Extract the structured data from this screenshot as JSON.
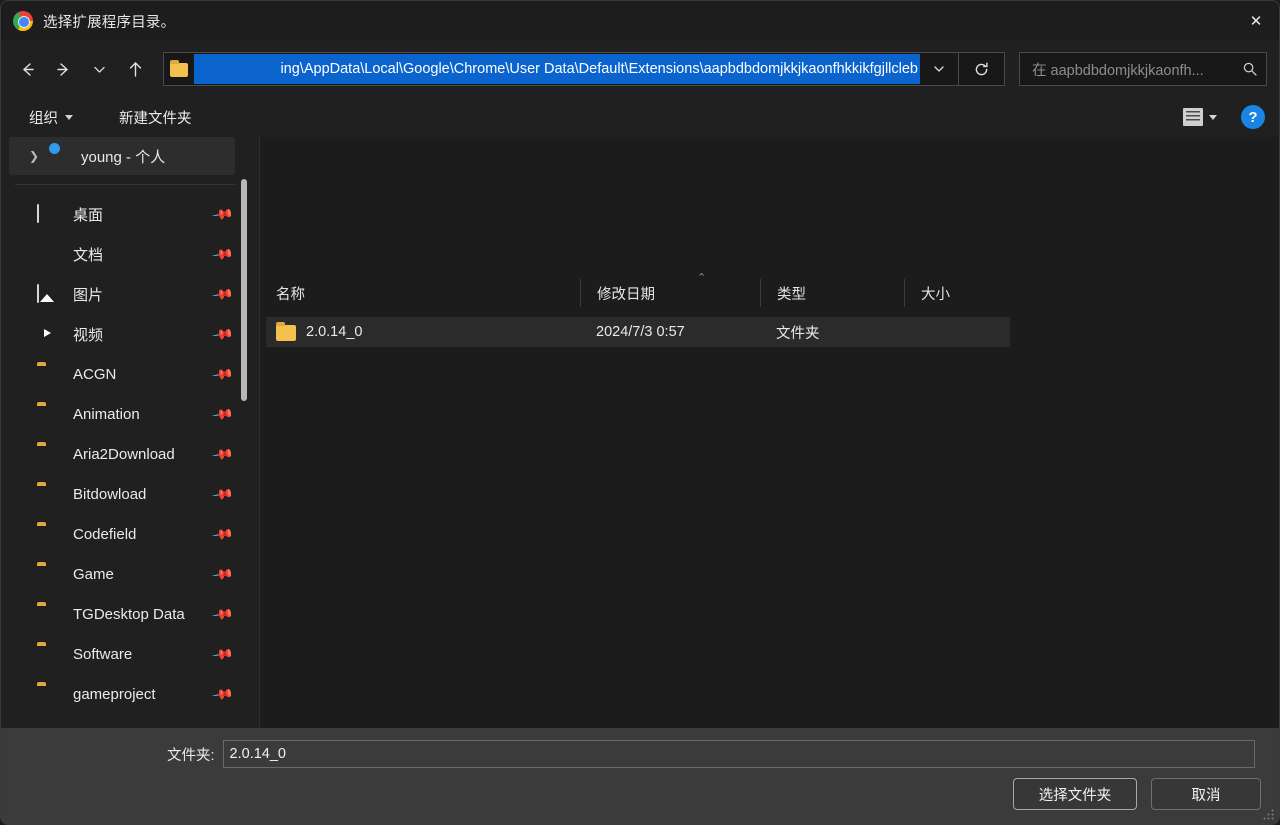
{
  "window": {
    "title": "选择扩展程序目录。",
    "app_icon": "chrome-logo-icon",
    "close_label": "✕"
  },
  "navigation": {
    "back_icon": "arrow-left-icon",
    "forward_icon": "arrow-right-icon",
    "recent_icon": "chevron-down-icon",
    "up_icon": "arrow-up-icon",
    "address": {
      "folder_icon": "folder-icon",
      "value": "ing\\AppData\\Local\\Google\\Chrome\\User Data\\Default\\Extensions\\aapbdbdomjkkjkaonfhkkikfgjllcleb",
      "selected": true,
      "dropdown_icon": "chevron-down-icon"
    },
    "refresh_icon": "refresh-icon",
    "search": {
      "placeholder": "在 aapbdbdomjkkjkaonfh...",
      "value": "",
      "icon": "search-icon"
    }
  },
  "commandbar": {
    "organize_label": "组织",
    "new_folder_label": "新建文件夹",
    "view_icon": "list-view-icon",
    "view_dropdown_icon": "chevron-down-icon",
    "help_icon": "help-icon",
    "help_label": "?"
  },
  "sidebar": {
    "root": {
      "label": "young - 个人",
      "icon": "onedrive-cloud-icon",
      "expander": "chevron-right-icon",
      "selected": true
    },
    "items": [
      {
        "label": "桌面",
        "icon": "desktop-icon",
        "pinned": true
      },
      {
        "label": "文档",
        "icon": "document-icon",
        "pinned": true
      },
      {
        "label": "图片",
        "icon": "picture-icon",
        "pinned": true
      },
      {
        "label": "视频",
        "icon": "video-icon",
        "pinned": true
      },
      {
        "label": "ACGN",
        "icon": "folder-icon",
        "pinned": true
      },
      {
        "label": "Animation",
        "icon": "folder-icon",
        "pinned": true
      },
      {
        "label": "Aria2Download",
        "icon": "folder-icon",
        "pinned": true
      },
      {
        "label": "Bitdowload",
        "icon": "folder-icon",
        "pinned": true
      },
      {
        "label": "Codefield",
        "icon": "folder-icon",
        "pinned": true
      },
      {
        "label": "Game",
        "icon": "folder-icon",
        "pinned": true
      },
      {
        "label": "TGDesktop Data",
        "icon": "folder-icon",
        "pinned": true
      },
      {
        "label": "Software",
        "icon": "folder-icon",
        "pinned": true
      },
      {
        "label": "gameproject",
        "icon": "folder-icon",
        "pinned": true
      }
    ],
    "pin_icon": "pin-icon",
    "pin_glyph": "📌"
  },
  "filelist": {
    "sort_indicator": "ascending-caret-icon",
    "sort_glyph": "⌃",
    "columns": [
      {
        "key": "name",
        "label": "名称"
      },
      {
        "key": "date",
        "label": "修改日期"
      },
      {
        "key": "type",
        "label": "类型"
      },
      {
        "key": "size",
        "label": "大小"
      }
    ],
    "rows": [
      {
        "icon": "folder-icon",
        "name": "2.0.14_0",
        "date": "2024/7/3 0:57",
        "type": "文件夹",
        "size": "",
        "selected": true
      }
    ]
  },
  "footer": {
    "folder_label": "文件夹:",
    "folder_value": "2.0.14_0",
    "select_button": "选择文件夹",
    "cancel_button": "取消",
    "resize_grip": "resize-grip-icon"
  },
  "colors": {
    "selection_blue": "#0b63ce",
    "help_blue": "#1a84e0",
    "folder_yellow": "#f4c04e",
    "window_bg": "#202020",
    "footer_bg": "#3b3b3b"
  }
}
